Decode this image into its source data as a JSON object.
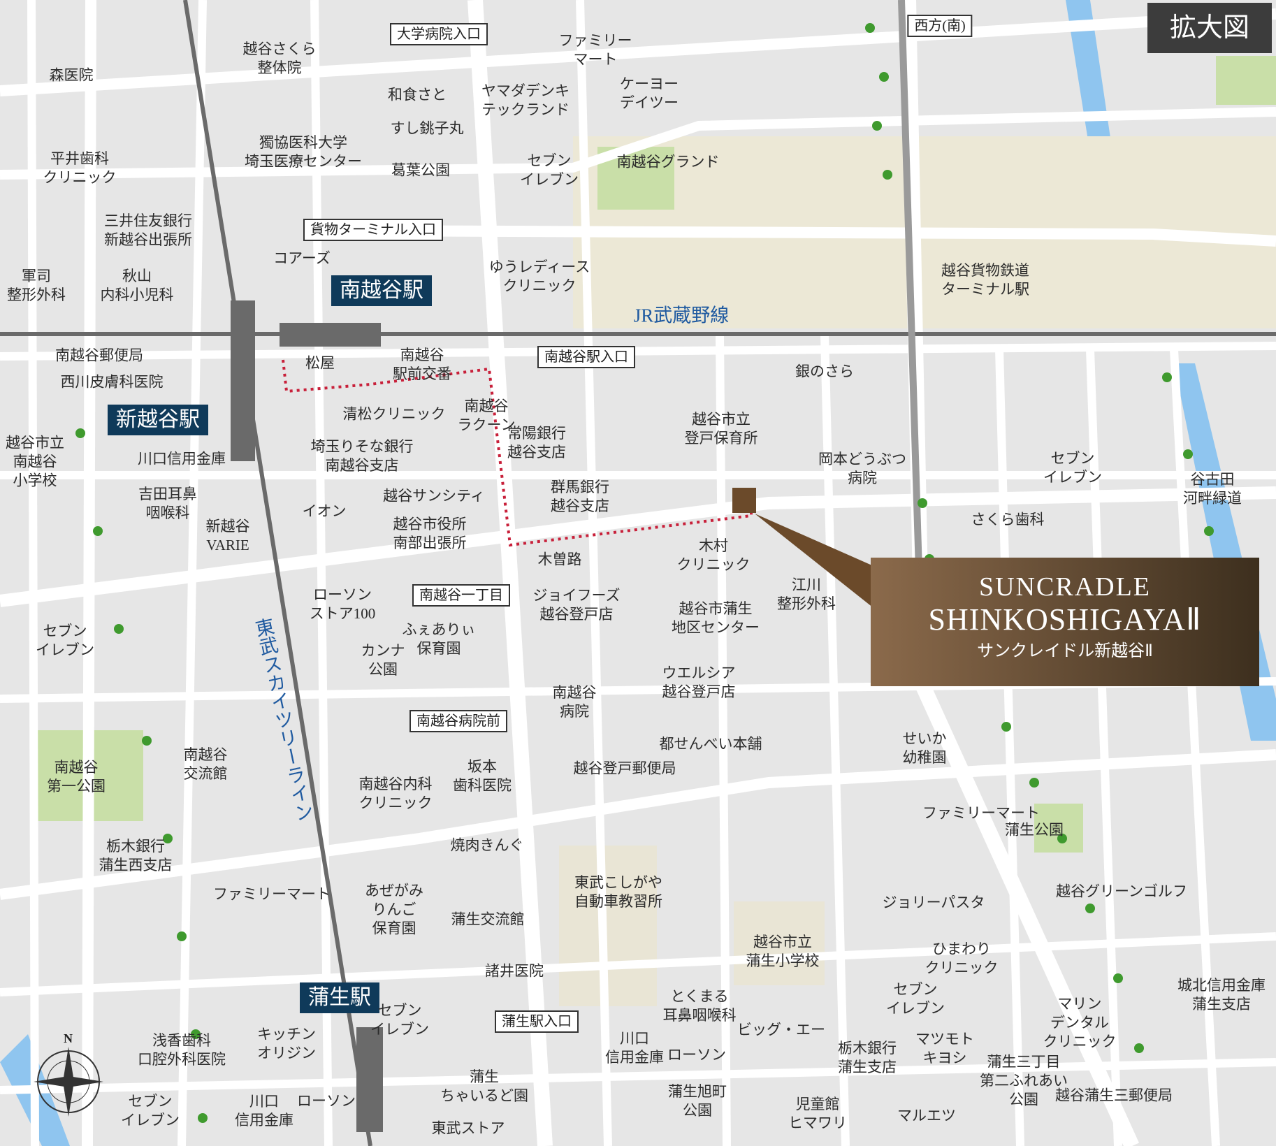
{
  "badge": "拡大図",
  "compass": {
    "north": "N"
  },
  "property": {
    "name_en_line1": "SUNCRADLE",
    "name_en_line2": "SHINKOSHIGAYAⅡ",
    "name_ja": "サンクレイドル新越谷Ⅱ"
  },
  "stations": {
    "minami_koshigaya": "南越谷駅",
    "shin_koshigaya": "新越谷駅",
    "gamo": "蒲生駅"
  },
  "rail_lines": {
    "jr_musashino": "JR武蔵野線",
    "tobu_skytree": "東武スカイツリーライン"
  },
  "boxed_labels": [
    "大学病院入口",
    "西方(南)",
    "貨物ターミナル入口",
    "南越谷駅入口",
    "南越谷一丁目",
    "南越谷病院前",
    "蒲生駅入口"
  ],
  "places": [
    "森医院",
    "越谷さくら\n整体院",
    "ファミリー\nマート",
    "和食さと",
    "ヤマダデンキ\nテックランド",
    "ケーヨー\nデイツー",
    "平井歯科\nクリニック",
    "獨協医科大学\n埼玉医療センター",
    "すし銚子丸",
    "葛葉公園",
    "セブン\nイレブン",
    "南越谷グランド",
    "三井住友銀行\n新越谷出張所",
    "コアーズ",
    "ゆうレディース\nクリニック",
    "越谷貨物鉄道\nターミナル駅",
    "軍司\n整形外科",
    "秋山\n内科小児科",
    "南越谷郵便局",
    "松屋",
    "南越谷\n駅前交番",
    "銀のさら",
    "西川皮膚科医院",
    "清松クリニック",
    "南越谷\nラクーン",
    "越谷市立\n登戸保育所",
    "越谷市立\n南越谷\n小学校",
    "埼玉りそな銀行\n南越谷支店",
    "常陽銀行\n越谷支店",
    "岡本どうぶつ\n病院",
    "セブン\nイレブン",
    "川口信用金庫",
    "吉田耳鼻\n咽喉科",
    "越谷サンシティ",
    "群馬銀行\n越谷支店",
    "谷古田\n河畔緑道",
    "イオン",
    "越谷市役所\n南部出張所",
    "さくら歯科",
    "新越谷\nVARIE",
    "木曽路",
    "木村\nクリニック",
    "ローソン\nストア100",
    "江川\n整形外科",
    "ジョイフーズ\n越谷登戸店",
    "越谷市蒲生\n地区センター",
    "セブン\nイレブン",
    "ふぇありぃ\n保育園",
    "カンナ\n公園",
    "ウエルシア\n越谷登戸店",
    "南越谷\n病院",
    "南越谷\n第一公園",
    "南越谷\n交流館",
    "都せんべい本舗",
    "せいか\n幼稚園",
    "南越谷内科\nクリニック",
    "坂本\n歯科医院",
    "越谷登戸郵便局",
    "ファミリーマート",
    "蒲生公園",
    "栃木銀行\n蒲生西支店",
    "焼肉きんぐ",
    "ファミリーマート",
    "あぜがみ\nりんご\n保育園",
    "東武こしがや\n自動車教習所",
    "越谷グリーンゴルフ",
    "ジョリーパスタ",
    "蒲生交流館",
    "越谷市立\n蒲生小学校",
    "ひまわり\nクリニック",
    "諸井医院",
    "城北信用金庫\n蒲生支店",
    "とくまる\n耳鼻咽喉科",
    "セブン\nイレブン",
    "セブン\nイレブン",
    "マリン\nデンタル\nクリニック",
    "浅香歯科\n口腔外科医院",
    "キッチン\nオリジン",
    "川口\n信用金庫",
    "ビッグ・エー",
    "マツモト\nキヨシ",
    "ローソン",
    "栃木銀行\n蒲生支店",
    "蒲生三丁目\n第二ふれあい\n公園",
    "蒲生\nちゃいるど園",
    "蒲生旭町\n公園",
    "越谷蒲生三郵便局",
    "セブン\nイレブン",
    "川口\n信用金庫",
    "ローソン",
    "児童館\nヒマワリ",
    "マルエツ",
    "東武ストア"
  ],
  "colors": {
    "map_bg": "#e6e6e6",
    "road": "#ffffff",
    "block": "#e0ddd0",
    "park": "#c9dfa8",
    "tree": "#3f9a2e",
    "river": "#8fc5ef",
    "rail": "#6a6a6a",
    "route": "#c8203a",
    "station_label": "#0f3a5a",
    "property_dark": "#3d2f1e"
  }
}
